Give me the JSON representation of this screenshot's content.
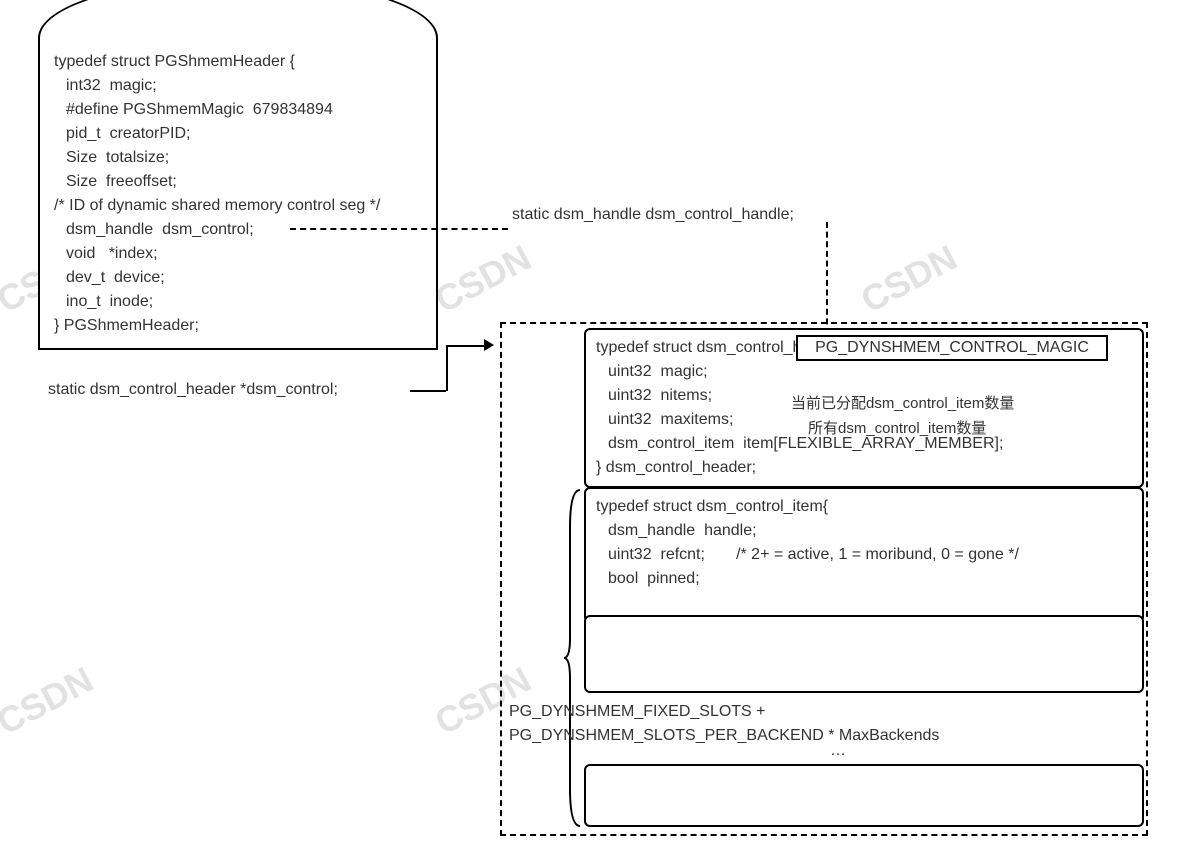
{
  "pgshmem": {
    "l1": "typedef struct PGShmemHeader {",
    "l2": "int32  magic;",
    "l3": "#define PGShmemMagic  679834894",
    "l4": "pid_t  creatorPID;",
    "l5": "Size  totalsize;",
    "l6": "Size  freeoffset;",
    "l7": "/* ID of dynamic shared memory control seg */",
    "l8": "dsm_handle  dsm_control;",
    "l9": "void   *index;",
    "l10": "dev_t  device;",
    "l11": "ino_t  inode;",
    "l12": "} PGShmemHeader;"
  },
  "labels": {
    "handle_decl": "static dsm_handle dsm_control_handle;",
    "ctrl_decl": "static dsm_control_header *dsm_control;"
  },
  "header": {
    "l1": "typedef struct dsm_control_header{",
    "l2": "uint32  magic;",
    "l3": "uint32  nitems;",
    "l4": "uint32  maxitems;",
    "l5": "dsm_control_item  item[FLEXIBLE_ARRAY_MEMBER];",
    "l6": "} dsm_control_header;",
    "magic_box": "PG_DYNSHMEM_CONTROL_MAGIC",
    "nitems_note": "当前已分配dsm_control_item数量",
    "maxitems_note": "所有dsm_control_item数量"
  },
  "item": {
    "l1": "typedef struct dsm_control_item{",
    "l2": "dsm_handle  handle;",
    "l3": "uint32  refcnt;       /* 2+ = active, 1 = moribund, 0 = gone */",
    "l4": "bool  pinned;"
  },
  "slots_formula": "PG_DYNSHMEM_FIXED_SLOTS +\nPG_DYNSHMEM_SLOTS_PER_BACKEND * MaxBackends",
  "ellipsis": "…",
  "watermark": "CSDN"
}
